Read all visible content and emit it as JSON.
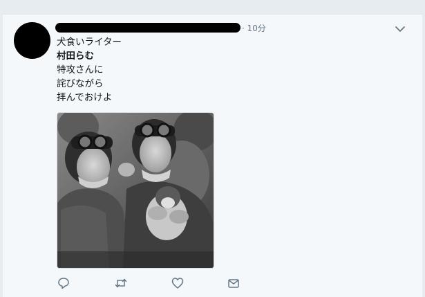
{
  "tweet": {
    "time": "· 10分",
    "lines": [
      "犬食いライター",
      "村田らむ",
      "特攻さんに",
      "詫びながら",
      "拝んでおけよ"
    ]
  },
  "icons": {
    "more": "chevron-down-icon",
    "reply": "reply-icon",
    "retweet": "retweet-icon",
    "like": "heart-icon",
    "dm": "envelope-icon"
  },
  "colors": {
    "background": "#e6ecf0",
    "card": "#f5f8fa",
    "icon_gray": "#657786",
    "text": "#14171a"
  }
}
